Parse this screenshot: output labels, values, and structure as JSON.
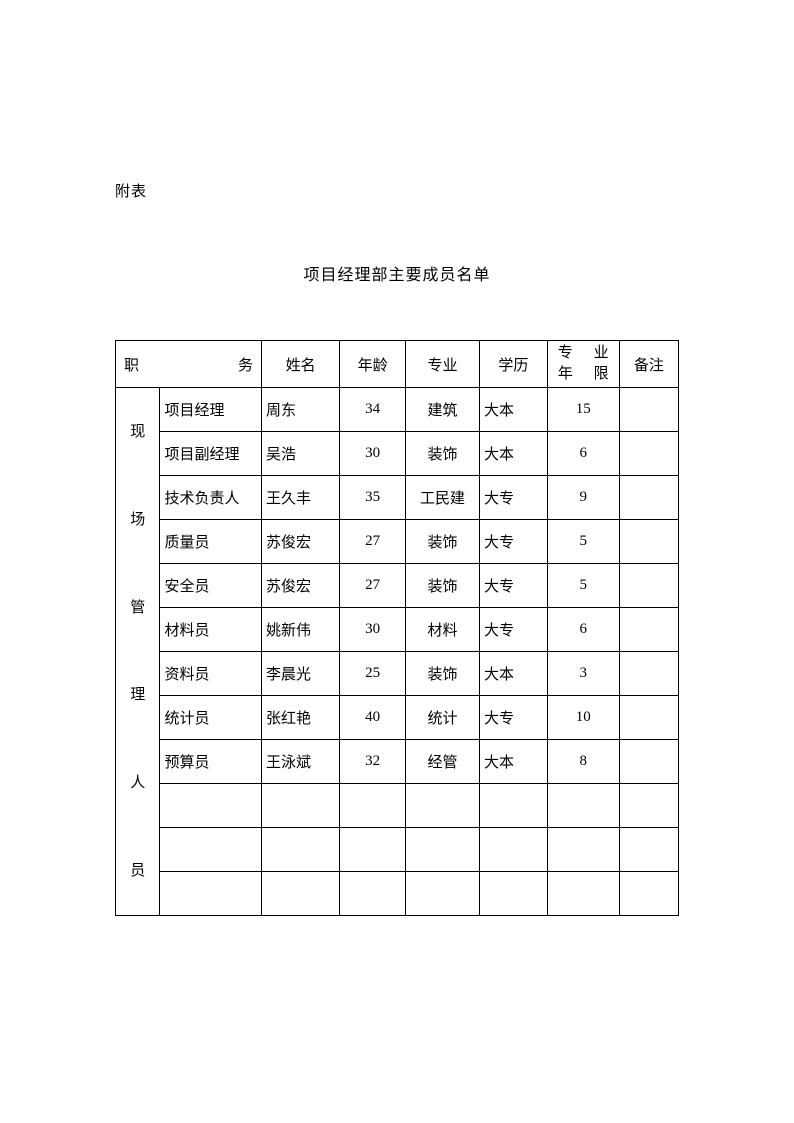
{
  "annex_label": "附表",
  "title": "项目经理部主要成员名单",
  "headers": {
    "position": "职务",
    "name": "姓名",
    "age": "年龄",
    "major": "专业",
    "education": "学历",
    "years_l1a": "专",
    "years_l1b": "业",
    "years_l2a": "年",
    "years_l2b": "限",
    "note": "备注"
  },
  "group_label": {
    "c1": "现",
    "c2": "场",
    "c3": "管",
    "c4": "理",
    "c5": "人",
    "c6": "员"
  },
  "rows": [
    {
      "position": "项目经理",
      "name": "周东",
      "age": "34",
      "major": "建筑",
      "education": "大本",
      "years": "15",
      "note": ""
    },
    {
      "position": "项目副经理",
      "name": "吴浩",
      "age": "30",
      "major": "装饰",
      "education": "大本",
      "years": "6",
      "note": ""
    },
    {
      "position": "技术负责人",
      "name": "王久丰",
      "age": "35",
      "major": "工民建",
      "education": "大专",
      "years": "9",
      "note": ""
    },
    {
      "position": "质量员",
      "name": "苏俊宏",
      "age": "27",
      "major": "装饰",
      "education": "大专",
      "years": "5",
      "note": ""
    },
    {
      "position": "安全员",
      "name": "苏俊宏",
      "age": "27",
      "major": "装饰",
      "education": "大专",
      "years": "5",
      "note": ""
    },
    {
      "position": "材料员",
      "name": "姚新伟",
      "age": "30",
      "major": "材料",
      "education": "大专",
      "years": "6",
      "note": ""
    },
    {
      "position": "资料员",
      "name": "李晨光",
      "age": "25",
      "major": "装饰",
      "education": "大本",
      "years": "3",
      "note": ""
    },
    {
      "position": "统计员",
      "name": "张红艳",
      "age": "40",
      "major": "统计",
      "education": "大专",
      "years": "10",
      "note": ""
    },
    {
      "position": "预算员",
      "name": "王泳斌",
      "age": "32",
      "major": "经管",
      "education": "大本",
      "years": "8",
      "note": ""
    },
    {
      "position": "",
      "name": "",
      "age": "",
      "major": "",
      "education": "",
      "years": "",
      "note": ""
    },
    {
      "position": "",
      "name": "",
      "age": "",
      "major": "",
      "education": "",
      "years": "",
      "note": ""
    },
    {
      "position": "",
      "name": "",
      "age": "",
      "major": "",
      "education": "",
      "years": "",
      "note": ""
    }
  ]
}
